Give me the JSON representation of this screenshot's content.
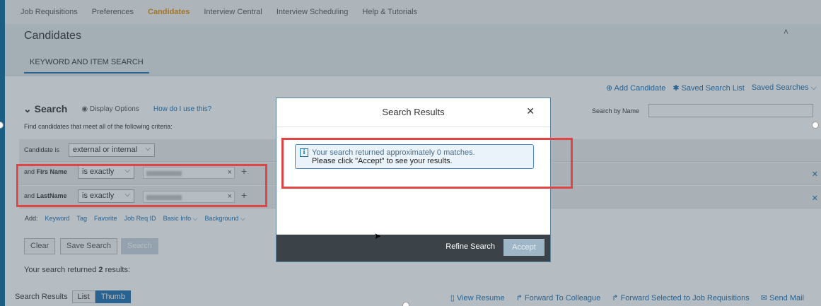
{
  "nav": {
    "items": [
      {
        "label": "Job Requisitions"
      },
      {
        "label": "Preferences"
      },
      {
        "label": "Candidates"
      },
      {
        "label": "Interview Central"
      },
      {
        "label": "Interview Scheduling"
      },
      {
        "label": "Help & Tutorials"
      }
    ],
    "active": "Candidates"
  },
  "header": {
    "title": "Candidates",
    "tab_label": "KEYWORD AND ITEM SEARCH",
    "caret": "˄"
  },
  "actions": {
    "add_candidate": "Add Candidate",
    "saved_search_list": "Saved Search List",
    "saved_searches": "Saved Searches"
  },
  "search": {
    "title": "Search",
    "display_options": "Display Options",
    "how_to": "How do I use this?",
    "criteria_text": "Find candidates that meet all of the following criteria:",
    "search_by_name_label": "Search by Name",
    "candidate_is_label": "Candidate is",
    "candidate_is_value": "external or internal",
    "first_name_prefix": "and ",
    "first_name_label": "Firs Name",
    "first_name_op": "is exactly",
    "last_name_prefix": "and ",
    "last_name_label": "LastName",
    "last_name_op": "is exactly",
    "add_label": "Add:",
    "add_links": [
      "Keyword",
      "Tag",
      "Favorite",
      "Job Req ID",
      "Basic Info",
      "Background"
    ],
    "clear_label": "Clear",
    "save_search_label": "Save Search",
    "search_label": "Search"
  },
  "results": {
    "prefix": "Your search returned ",
    "count": "2",
    "suffix": " results:",
    "bar_label": "Search Results",
    "view_list": "List",
    "view_thumb": "Thumb",
    "view_resume": "View Resume",
    "forward_colleague": "Forward To Colleague",
    "forward_selected": "Forward Selected to Job Requisitions",
    "send_mail": "Send Mail"
  },
  "dialog": {
    "title": "Search Results",
    "message_line1": "Your search returned approximately 0 matches.",
    "message_line2": "Please click \"Accept\" to see your results.",
    "refine_label": "Refine Search",
    "accept_label": "Accept"
  },
  "colors": {
    "accent": "#1a6fb0",
    "active_nav": "#e08e0b",
    "highlight": "#e04545"
  }
}
